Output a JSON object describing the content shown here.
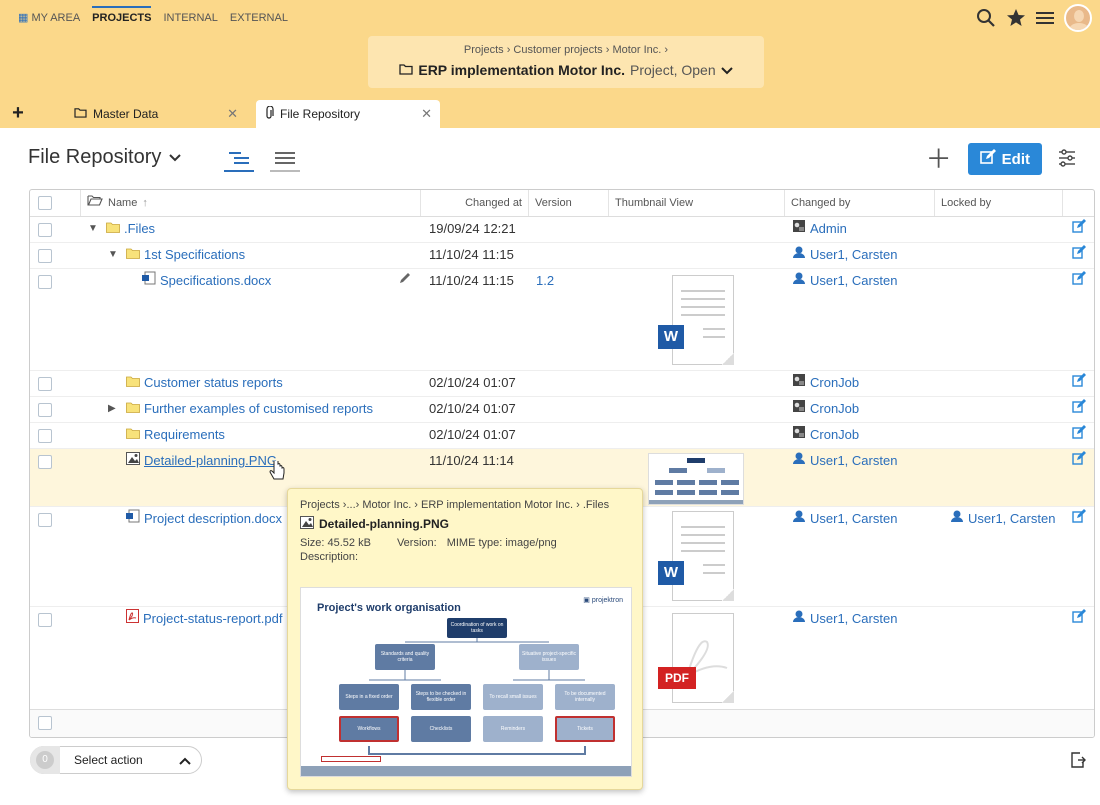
{
  "nav": {
    "items": [
      "MY AREA",
      "PROJECTS",
      "INTERNAL",
      "EXTERNAL"
    ],
    "active": 1
  },
  "breadcrumb": {
    "path": "Projects  ›  Customer projects  ›  Motor Inc.  ›",
    "title": "ERP implementation Motor Inc.",
    "subtitle": "Project, Open"
  },
  "tabs": [
    "Master Data",
    "File Repository"
  ],
  "page": {
    "title": "File Repository",
    "edit_label": "Edit"
  },
  "columns": {
    "name": "Name",
    "changed_at": "Changed at",
    "version": "Version",
    "thumbnail": "Thumbnail View",
    "changed_by": "Changed by",
    "locked_by": "Locked by"
  },
  "rows": [
    {
      "name": ".Files",
      "changed": "19/09/24 12:21",
      "version": "",
      "changed_by": "Admin",
      "locked_by": ""
    },
    {
      "name": "1st Specifications",
      "changed": "11/10/24 11:15",
      "version": "",
      "changed_by": "User1, Carsten",
      "locked_by": ""
    },
    {
      "name": "Specifications.docx",
      "changed": "11/10/24 11:15",
      "version": "1.2",
      "changed_by": "User1, Carsten",
      "locked_by": ""
    },
    {
      "name": "Customer status reports",
      "changed": "02/10/24 01:07",
      "version": "",
      "changed_by": "CronJob",
      "locked_by": ""
    },
    {
      "name": "Further examples of customised reports",
      "changed": "02/10/24 01:07",
      "version": "",
      "changed_by": "CronJob",
      "locked_by": ""
    },
    {
      "name": "Requirements",
      "changed": "02/10/24 01:07",
      "version": "",
      "changed_by": "CronJob",
      "locked_by": ""
    },
    {
      "name": "Detailed-planning.PNG",
      "changed": "11/10/24 11:14",
      "version": "",
      "changed_by": "User1, Carsten",
      "locked_by": ""
    },
    {
      "name": "Project description.docx",
      "changed": "",
      "version": "",
      "changed_by": "User1, Carsten",
      "locked_by": "User1, Carsten"
    },
    {
      "name": "Project-status-report.pdf",
      "changed": "",
      "version": "",
      "changed_by": "User1, Carsten",
      "locked_by": ""
    }
  ],
  "thumbs": {
    "word": "W",
    "pdf": "PDF"
  },
  "tooltip": {
    "path": "Projects ›...› Motor Inc. › ERP implementation Motor Inc. › .Files",
    "title": "Detailed-planning.PNG",
    "size": "Size:  45.52 kB",
    "version": "Version:",
    "mime": "MIME type:  image/png",
    "description": "Description:",
    "preview": {
      "title": "Project's work organisation",
      "logo": "projektron",
      "boxes": [
        "Coordination of work on tasks",
        "Standards and quality criteria",
        "Situative project-specific issues",
        "Steps in a fixed order",
        "Steps to be checked in flexible order",
        "To recall small issues",
        "To be documented internally",
        "Workflows",
        "Checklists",
        "Reminders",
        "Tickets"
      ]
    }
  },
  "footer": {
    "count": "0",
    "action_label": "Select action"
  },
  "colors": {
    "header_bg": "#fbd88a",
    "accent": "#2a88d8",
    "link": "#2a6ebb"
  }
}
